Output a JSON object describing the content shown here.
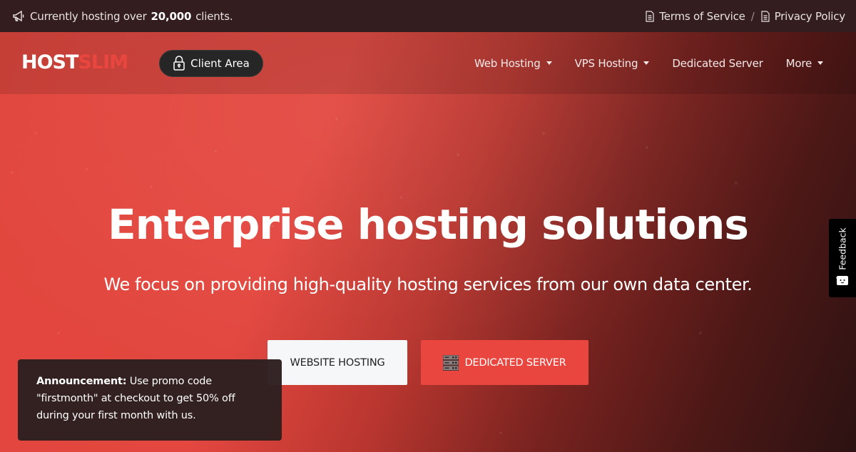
{
  "topbar": {
    "announcement_prefix": "Currently hosting over",
    "announcement_count": "20,000",
    "announcement_suffix": "clients.",
    "announcement_icon": "megaphone-icon",
    "links": [
      {
        "label": "Terms of Service",
        "icon": "document-icon"
      },
      {
        "label": "Privacy Policy",
        "icon": "document-icon"
      }
    ],
    "separator": "/"
  },
  "navbar": {
    "logo_part1": "HOST",
    "logo_part2": "SLIM",
    "client_area_label": "Client Area",
    "client_area_icon": "lock-icon",
    "items": [
      {
        "label": "Web Hosting",
        "dropdown": true
      },
      {
        "label": "VPS Hosting",
        "dropdown": true
      },
      {
        "label": "Dedicated Server",
        "dropdown": false
      },
      {
        "label": "More",
        "dropdown": true
      }
    ]
  },
  "hero": {
    "headline_regular": "Enterprise",
    "headline_bold": "hosting",
    "headline_end": "solutions",
    "subheadline": "We focus on providing high-quality hosting services from our own data center.",
    "buttons": [
      {
        "label": "WEBSITE HOSTING"
      },
      {
        "label": "DEDICATED SERVER",
        "icon": "server-rack-icon"
      }
    ]
  },
  "announcement": {
    "title": "Announcement:",
    "body": "Use promo code \"firstmonth\" at checkout to get 50% off during your first month with us."
  },
  "feedback": {
    "label": "Feedback",
    "icon": "chat-face-icon"
  },
  "colors": {
    "brand_red": "#e8463f",
    "topbar_bg": "#331d1e",
    "client_btn_bg": "#262626",
    "announce_bg": "#2d1f1f"
  }
}
